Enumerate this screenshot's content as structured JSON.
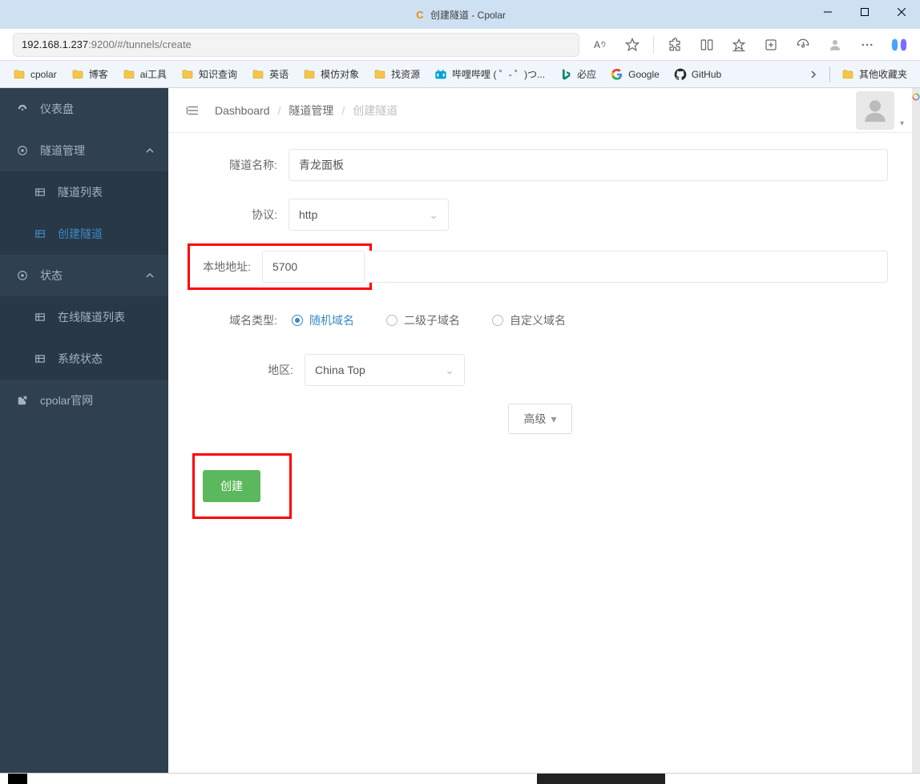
{
  "window": {
    "title": "创建隧道 - Cpolar"
  },
  "browser": {
    "url_host": "192.168.1.237",
    "url_port_path": ":9200/#/tunnels/create",
    "aa_label": "A",
    "bookmarks": [
      {
        "label": "cpolar",
        "kind": "folder"
      },
      {
        "label": "博客",
        "kind": "folder"
      },
      {
        "label": "ai工具",
        "kind": "folder"
      },
      {
        "label": "知识查询",
        "kind": "folder"
      },
      {
        "label": "英语",
        "kind": "folder"
      },
      {
        "label": "模仿对象",
        "kind": "folder"
      },
      {
        "label": "找资源",
        "kind": "folder"
      },
      {
        "label": "哔哩哔哩 (  ゜- ゜)つ...",
        "kind": "bili"
      },
      {
        "label": "必应",
        "kind": "bing"
      },
      {
        "label": "Google",
        "kind": "google"
      },
      {
        "label": "GitHub",
        "kind": "github"
      }
    ],
    "bookmarks_overflow": "其他收藏夹"
  },
  "sidebar": {
    "items": [
      {
        "label": "仪表盘",
        "icon": "gauge"
      },
      {
        "label": "隧道管理",
        "icon": "target",
        "expanded": true,
        "children": [
          {
            "label": "隧道列表"
          },
          {
            "label": "创建隧道",
            "active": true
          }
        ]
      },
      {
        "label": "状态",
        "icon": "target",
        "expanded": true,
        "children": [
          {
            "label": "在线隧道列表"
          },
          {
            "label": "系统状态"
          }
        ]
      },
      {
        "label": "cpolar官网",
        "icon": "external"
      }
    ]
  },
  "breadcrumbs": {
    "a": "Dashboard",
    "b": "隧道管理",
    "c": "创建隧道"
  },
  "form": {
    "name_label": "隧道名称:",
    "name_value": "青龙面板",
    "proto_label": "协议:",
    "proto_value": "http",
    "addr_label": "本地地址:",
    "addr_value": "5700",
    "domaintype_label": "域名类型:",
    "domain_opts": [
      "随机域名",
      "二级子域名",
      "自定义域名"
    ],
    "region_label": "地区:",
    "region_value": "China Top",
    "adv_label": "高级",
    "submit_label": "创建"
  }
}
